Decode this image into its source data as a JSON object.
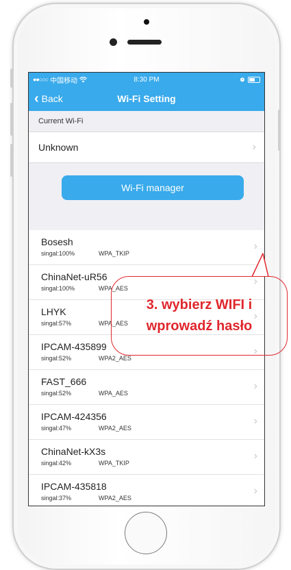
{
  "status_bar": {
    "signal_dots": "●●○○○",
    "carrier": "中国移动",
    "wifi_icon": "wifi-icon",
    "time": "8:30 PM",
    "alarm_icon": "alarm-icon"
  },
  "nav": {
    "back_label": "Back",
    "title": "Wi-Fi Setting"
  },
  "current_section": {
    "label": "Current Wi-Fi",
    "value": "Unknown"
  },
  "manager_button": "Wi-Fi manager",
  "wifi_list": [
    {
      "name": "Bosesh",
      "signal": "singal:100%",
      "security": "WPA_TKIP"
    },
    {
      "name": "ChinaNet-uR56",
      "signal": "singal:100%",
      "security": "WPA_AES"
    },
    {
      "name": "LHYK",
      "signal": "singal:57%",
      "security": "WPA_AES"
    },
    {
      "name": "IPCAM-435899",
      "signal": "singal:52%",
      "security": "WPA2_AES"
    },
    {
      "name": "FAST_666",
      "signal": "singal:52%",
      "security": "WPA_AES"
    },
    {
      "name": "IPCAM-424356",
      "signal": "singal:47%",
      "security": "WPA2_AES"
    },
    {
      "name": "ChinaNet-kX3s",
      "signal": "singal:42%",
      "security": "WPA_TKIP"
    },
    {
      "name": "IPCAM-435818",
      "signal": "singal:37%",
      "security": "WPA2_AES"
    }
  ],
  "annotation": {
    "line1": "3. wybierz WIFI i",
    "line2": "wprowadź hasło",
    "color": "#e0262c"
  },
  "colors": {
    "accent": "#39aaeb",
    "background": "#efeff4"
  }
}
